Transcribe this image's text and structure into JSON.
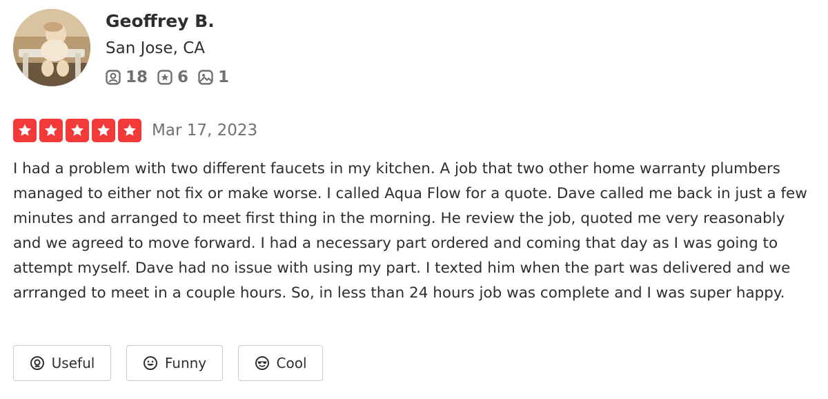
{
  "user": {
    "name": "Geoffrey B.",
    "location": "San Jose, CA",
    "stats": {
      "friends": "18",
      "reviews": "6",
      "photos": "1"
    }
  },
  "review": {
    "rating": 5,
    "date": "Mar 17, 2023",
    "text": "I had a problem with two different faucets in my kitchen. A job that two other home warranty plumbers managed to either not fix or make worse. I called Aqua Flow for a quote. Dave called me back in just a few minutes and arranged to meet first thing in the morning. He review the job, quoted me very reasonably and we agreed to move forward. I had a necessary part ordered and coming that day as I was going to attempt myself. Dave had no issue with using my part. I texted him when the part was delivered and we arrranged to meet in a couple hours. So, in less than 24 hours job was complete and I was super happy."
  },
  "reactions": {
    "useful_label": "Useful",
    "funny_label": "Funny",
    "cool_label": "Cool"
  },
  "icons": {
    "friends": "friends-icon",
    "reviews": "review-star-icon",
    "photos": "photo-icon",
    "useful": "lightbulb-icon",
    "funny": "smile-icon",
    "cool": "sunglasses-icon",
    "star": "star-icon"
  },
  "colors": {
    "star_red": "#f43939",
    "text_dark": "#2d2e2f",
    "text_gray": "#6e7072",
    "border": "#c8c9ca"
  }
}
